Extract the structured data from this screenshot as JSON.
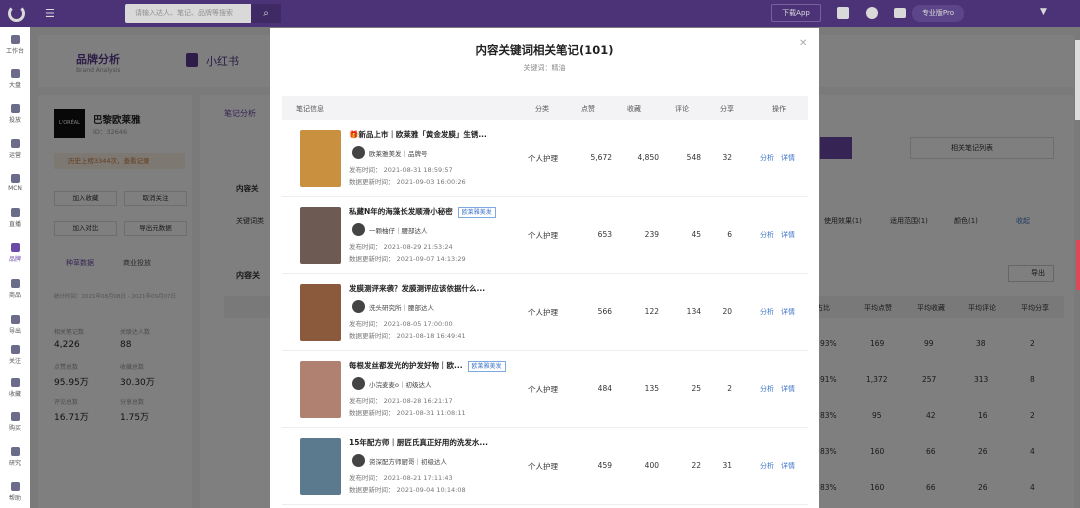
{
  "topbar": {
    "search_placeholder": "请输入达人、笔记、品牌等搜索",
    "download_label": "下载App",
    "vip_label": "专业版Pro"
  },
  "sidebar": {
    "items": [
      {
        "label": "工作台"
      },
      {
        "label": "大盘"
      },
      {
        "label": "投放"
      },
      {
        "label": "运营"
      },
      {
        "label": "MCN"
      },
      {
        "label": "直播"
      },
      {
        "label": "品牌"
      },
      {
        "label": "商品"
      },
      {
        "label": "导出"
      },
      {
        "label": "关注"
      },
      {
        "label": "收藏"
      },
      {
        "label": "购买"
      },
      {
        "label": "研究"
      },
      {
        "label": "帮助"
      }
    ]
  },
  "background": {
    "page_title": "品牌分析",
    "page_title_en": "Brand Analysis",
    "platform": "小红书",
    "brand_name": "巴黎欧莱雅",
    "brand_id": "ID：32646",
    "history_label": "历史上榜3344次，查看记录",
    "buttons": [
      "加入收藏",
      "取消关注",
      "加入对比",
      "导出元数据"
    ],
    "tabs": [
      "种草数据",
      "商业投放"
    ],
    "stat_period": "统计时间：2021年08月08日 - 2021年09月07日",
    "stats": [
      {
        "label": "相关笔记数",
        "value": "4,226"
      },
      {
        "label": "关联达人数",
        "value": "88"
      },
      {
        "label": "点赞总数",
        "value": "95.95万"
      },
      {
        "label": "收藏总数",
        "value": "30.30万"
      },
      {
        "label": "评论总数",
        "value": "16.71万"
      },
      {
        "label": "分享总数",
        "value": "1.75万"
      }
    ],
    "note_tab": "笔记分析",
    "note_list_btn": "相关笔记列表",
    "right_filters": [
      "使用效果(1)",
      "适用范围(1)",
      "颜色(1)",
      "收起"
    ],
    "keyword_label": "关键词类",
    "content_label": "内容关",
    "export_btn": "导出",
    "table_headers": [
      "占比",
      "平均点赞",
      "平均收藏",
      "平均评论",
      "平均分享"
    ],
    "table_rows": [
      [
        "93%",
        "169",
        "99",
        "38",
        "2"
      ],
      [
        "91%",
        "1,372",
        "257",
        "313",
        "8"
      ],
      [
        "83%",
        "95",
        "42",
        "16",
        "2"
      ],
      [
        "83%",
        "160",
        "66",
        "26",
        "4"
      ],
      [
        "83%",
        "160",
        "66",
        "26",
        "4"
      ]
    ]
  },
  "modal": {
    "title": "内容关键词相关笔记(101)",
    "keyword": "关键词：精油",
    "headers": [
      "笔记信息",
      "分类",
      "点赞",
      "收藏",
      "评论",
      "分享",
      "操作"
    ],
    "ops": [
      "分析",
      "详情"
    ],
    "publish_prefix": "发布时间：",
    "update_prefix": "数据更新时间：",
    "rows": [
      {
        "title": "🎁新品上市｜欧莱雅「黄金发膜」生锈...",
        "tag": "",
        "author": "欧莱雅美发｜品牌号",
        "publish": "2021-08-31 18:59:57",
        "update": "2021-09-03 16:00:26",
        "category": "个人护理",
        "likes": "5,672",
        "collects": "4,850",
        "comments": "548",
        "shares": "32",
        "thumb_color": "#c9913f"
      },
      {
        "title": "私藏N年的海藻长发顺滑小秘密",
        "tag": "欧莱雅美发",
        "author": "一颗柚仔｜腰部达人",
        "publish": "2021-08-29 21:53:24",
        "update": "2021-09-07 14:13:29",
        "category": "个人护理",
        "likes": "653",
        "collects": "239",
        "comments": "45",
        "shares": "6",
        "thumb_color": "#6d5b53"
      },
      {
        "title": "发膜测评来袭？发膜测评应该依据什么...",
        "tag": "",
        "author": "洗头研究所｜腰部达人",
        "publish": "2021-08-05 17:00:00",
        "update": "2021-08-18 16:49:41",
        "category": "个人护理",
        "likes": "566",
        "collects": "122",
        "comments": "134",
        "shares": "20",
        "thumb_color": "#8b5a3c"
      },
      {
        "title": "每根发丝都发光的护发好物｜欧...",
        "tag": "欧莱雅美发",
        "author": "小浣麦麦o｜初级达人",
        "publish": "2021-08-28 16:21:17",
        "update": "2021-08-31 11:08:11",
        "category": "个人护理",
        "likes": "484",
        "collects": "135",
        "comments": "25",
        "shares": "2",
        "thumb_color": "#b08070"
      },
      {
        "title": "15年配方师｜厨匠氏真正好用的洗发水...",
        "tag": "",
        "author": "资深配方师厨哥｜初级达人",
        "publish": "2021-08-21 17:11:43",
        "update": "2021-09-04 10:14:08",
        "category": "个人护理",
        "likes": "459",
        "collects": "400",
        "comments": "22",
        "shares": "31",
        "thumb_color": "#5c7a8e"
      }
    ]
  }
}
